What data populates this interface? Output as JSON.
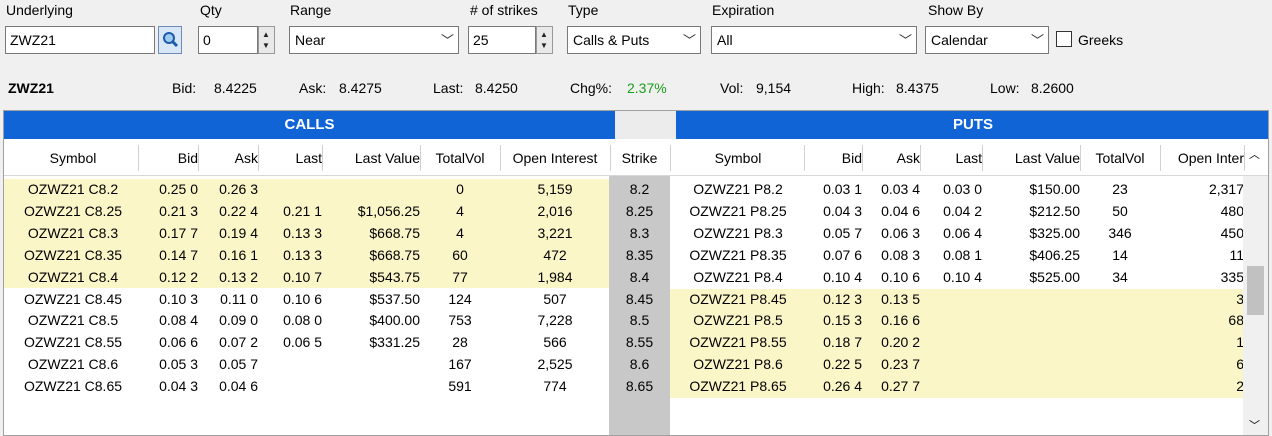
{
  "controls": {
    "underlying_label": "Underlying",
    "underlying_value": "ZWZ21",
    "qty_label": "Qty",
    "qty_value": "0",
    "range_label": "Range",
    "range_value": "Near",
    "strikes_label": "# of strikes",
    "strikes_value": "25",
    "type_label": "Type",
    "type_value": "Calls & Puts",
    "expiration_label": "Expiration",
    "expiration_value": "All",
    "showby_label": "Show By",
    "showby_value": "Calendar",
    "greeks_label": "Greeks"
  },
  "quote": {
    "symbol": "ZWZ21",
    "bid_label": "Bid:",
    "bid": "8.4225",
    "ask_label": "Ask:",
    "ask": "8.4275",
    "last_label": "Last:",
    "last": "8.4250",
    "chg_label": "Chg%:",
    "chg": "2.37%",
    "vol_label": "Vol:",
    "vol": "9,154",
    "high_label": "High:",
    "high": "8.4375",
    "low_label": "Low:",
    "low": "8.2600"
  },
  "chain": {
    "calls_title": "CALLS",
    "puts_title": "PUTS",
    "call_headers": [
      "Symbol",
      "Bid",
      "Ask",
      "Last",
      "Last Value",
      "TotalVol",
      "Open Interest"
    ],
    "strike_header": "Strike",
    "put_headers": [
      "Symbol",
      "Bid",
      "Ask",
      "Last",
      "Last Value",
      "TotalVol",
      "Open Inter"
    ],
    "rows": [
      {
        "call": [
          "OZWZ21 C8.2",
          "0.25 0",
          "0.26 3",
          "",
          "",
          "0",
          "5,159"
        ],
        "strike": "8.2",
        "put": [
          "OZWZ21 P8.2",
          "0.03 1",
          "0.03 4",
          "0.03 0",
          "$150.00",
          "23",
          "2,317"
        ],
        "call_itm": true,
        "put_itm": false
      },
      {
        "call": [
          "OZWZ21 C8.25",
          "0.21 3",
          "0.22 4",
          "0.21 1",
          "$1,056.25",
          "4",
          "2,016"
        ],
        "strike": "8.25",
        "put": [
          "OZWZ21 P8.25",
          "0.04 3",
          "0.04 6",
          "0.04 2",
          "$212.50",
          "50",
          "480"
        ],
        "call_itm": true,
        "put_itm": false
      },
      {
        "call": [
          "OZWZ21 C8.3",
          "0.17 7",
          "0.19 4",
          "0.13 3",
          "$668.75",
          "4",
          "3,221"
        ],
        "strike": "8.3",
        "put": [
          "OZWZ21 P8.3",
          "0.05 7",
          "0.06 3",
          "0.06 4",
          "$325.00",
          "346",
          "450"
        ],
        "call_itm": true,
        "put_itm": false
      },
      {
        "call": [
          "OZWZ21 C8.35",
          "0.14 7",
          "0.16 1",
          "0.13 3",
          "$668.75",
          "60",
          "472"
        ],
        "strike": "8.35",
        "put": [
          "OZWZ21 P8.35",
          "0.07 6",
          "0.08 3",
          "0.08 1",
          "$406.25",
          "14",
          "11"
        ],
        "call_itm": true,
        "put_itm": false
      },
      {
        "call": [
          "OZWZ21 C8.4",
          "0.12 2",
          "0.13 2",
          "0.10 7",
          "$543.75",
          "77",
          "1,984"
        ],
        "strike": "8.4",
        "put": [
          "OZWZ21 P8.4",
          "0.10 4",
          "0.10 6",
          "0.10 4",
          "$525.00",
          "34",
          "335"
        ],
        "call_itm": true,
        "put_itm": false
      },
      {
        "call": [
          "OZWZ21 C8.45",
          "0.10 3",
          "0.11 0",
          "0.10 6",
          "$537.50",
          "124",
          "507"
        ],
        "strike": "8.45",
        "put": [
          "OZWZ21 P8.45",
          "0.12 3",
          "0.13 5",
          "",
          "",
          "",
          "3"
        ],
        "call_itm": false,
        "put_itm": true
      },
      {
        "call": [
          "OZWZ21 C8.5",
          "0.08 4",
          "0.09 0",
          "0.08 0",
          "$400.00",
          "753",
          "7,228"
        ],
        "strike": "8.5",
        "put": [
          "OZWZ21 P8.5",
          "0.15 3",
          "0.16 6",
          "",
          "",
          "",
          "68"
        ],
        "call_itm": false,
        "put_itm": true
      },
      {
        "call": [
          "OZWZ21 C8.55",
          "0.06 6",
          "0.07 2",
          "0.06 5",
          "$331.25",
          "28",
          "566"
        ],
        "strike": "8.55",
        "put": [
          "OZWZ21 P8.55",
          "0.18 7",
          "0.20 2",
          "",
          "",
          "",
          "1"
        ],
        "call_itm": false,
        "put_itm": true
      },
      {
        "call": [
          "OZWZ21 C8.6",
          "0.05 3",
          "0.05 7",
          "",
          "",
          "167",
          "2,525"
        ],
        "strike": "8.6",
        "put": [
          "OZWZ21 P8.6",
          "0.22 5",
          "0.23 7",
          "",
          "",
          "",
          "6"
        ],
        "call_itm": false,
        "put_itm": true
      },
      {
        "call": [
          "OZWZ21 C8.65",
          "0.04 3",
          "0.04 6",
          "",
          "",
          "591",
          "774"
        ],
        "strike": "8.65",
        "put": [
          "OZWZ21 P8.65",
          "0.26 4",
          "0.27 7",
          "",
          "",
          "",
          "2"
        ],
        "call_itm": false,
        "put_itm": true
      }
    ]
  },
  "colors": {
    "banner": "#1064d6",
    "itm_highlight": "#fbf6c8",
    "strike_column": "#c8c8c8",
    "positive_change": "#1a9e1a"
  },
  "icons": [
    "search-icon",
    "spinner-up-icon",
    "spinner-down-icon",
    "chevron-down-icon",
    "checkbox-icon",
    "scroll-up-icon",
    "scroll-down-icon"
  ]
}
